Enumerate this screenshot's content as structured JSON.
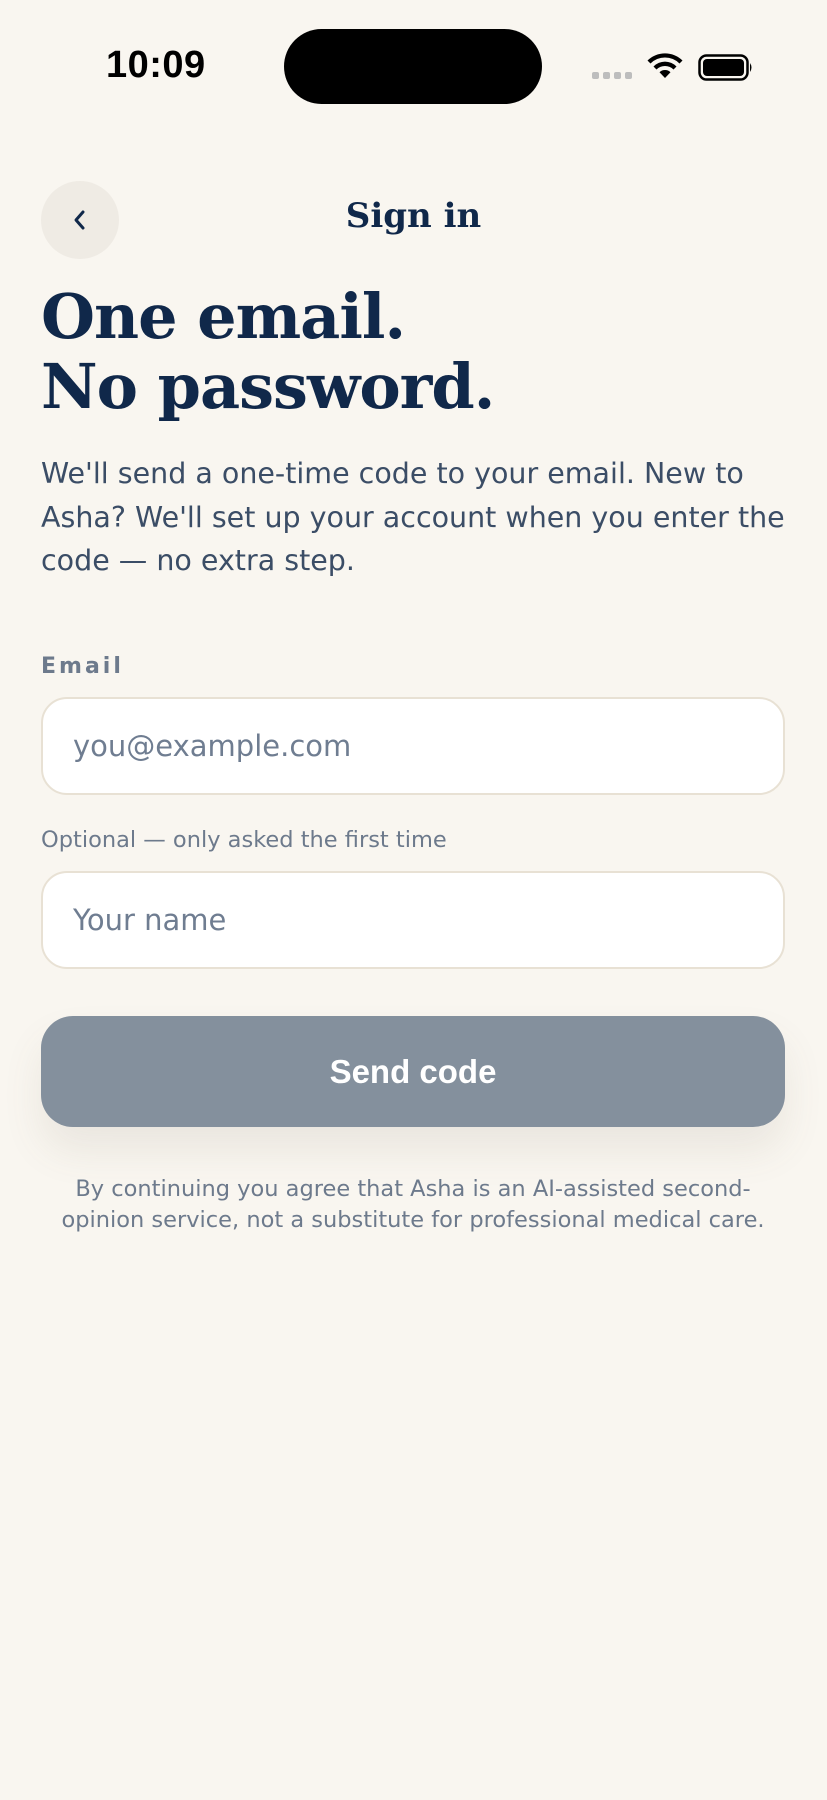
{
  "status_bar": {
    "time": "10:09"
  },
  "nav": {
    "back_icon": "chevron-left-icon",
    "title": "Sign in"
  },
  "headline": {
    "line1": "One email.",
    "line2": "No password."
  },
  "intro_text": "We'll send a one-time code to your email. New to Asha? We'll set up your account when you enter the code — no extra step.",
  "form": {
    "email_label": "Email",
    "email_value": "",
    "email_placeholder": "you@example.com",
    "name_hint": "Optional — only asked the first time",
    "name_value": "",
    "name_placeholder": "Your name",
    "submit_label": "Send code"
  },
  "disclaimer": "By continuing you agree that Asha is an AI-assisted second-opinion service, not a substitute for professional medical care.",
  "colors": {
    "background": "#f9f6f0",
    "primary_text": "#10284a",
    "button_disabled": "#84909d",
    "muted_text": "#6d7a8c"
  }
}
